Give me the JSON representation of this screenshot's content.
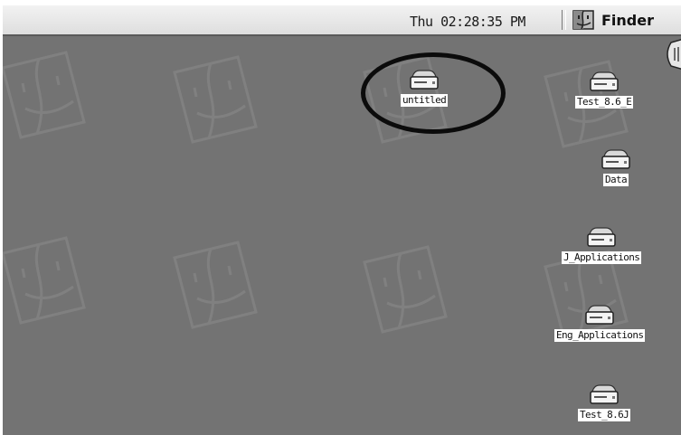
{
  "menubar": {
    "clock": "Thu 02:28:35 PM",
    "app_name": "Finder",
    "app_icon": "finder-icon"
  },
  "desktop": {
    "wallpaper_icon": "finder-face-icon",
    "highlighted_drive": "untitled",
    "drives": [
      {
        "label": "untitled",
        "icon": "hard-drive-icon"
      },
      {
        "label": "Test_8.6_E",
        "icon": "hard-drive-icon"
      },
      {
        "label": "Data",
        "icon": "hard-drive-icon"
      },
      {
        "label": "J_Applications",
        "icon": "hard-drive-icon"
      },
      {
        "label": "Eng_Applications",
        "icon": "hard-drive-icon"
      },
      {
        "label": "Test_8.6J",
        "icon": "hard-drive-icon"
      }
    ]
  }
}
